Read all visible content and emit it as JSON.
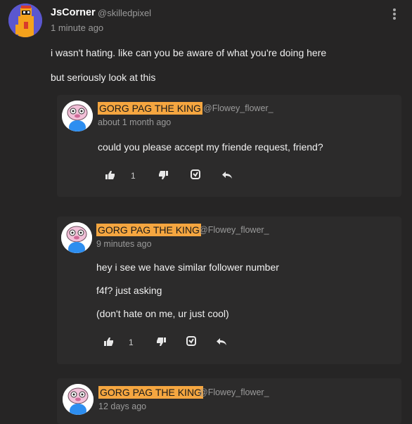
{
  "post": {
    "author": "JsCorner",
    "handle": "@skilledpixel",
    "time": "1 minute ago",
    "lines": [
      "i wasn't hating. like can you be aware of what you're doing here",
      "but seriously look at this"
    ]
  },
  "replies": [
    {
      "name": "GORG PAG THE KING",
      "handle": "@Flowey_flower_",
      "time": "about 1 month ago",
      "lines": [
        "could you please accept my friende request, friend?"
      ],
      "likes": "1"
    },
    {
      "name": "GORG PAG THE KING",
      "handle": "@Flowey_flower_",
      "time": "9 minutes ago",
      "lines": [
        "hey i see we have similar follower number",
        "f4f? just asking",
        "(don't hate on me, ur just cool)"
      ],
      "likes": "1"
    },
    {
      "name": "GORG PAG THE KING",
      "handle": "@Flowey_flower_",
      "time": "12 days ago",
      "lines": []
    }
  ],
  "colors": {
    "background": "#262525",
    "reply_background": "#2c2b2b",
    "name_highlight": "#f5a640",
    "muted_text": "#9a9a9a"
  },
  "icons": [
    "more-options-icon",
    "thumbs-up-icon",
    "thumbs-down-icon",
    "remix-icon",
    "reply-arrow-icon"
  ]
}
